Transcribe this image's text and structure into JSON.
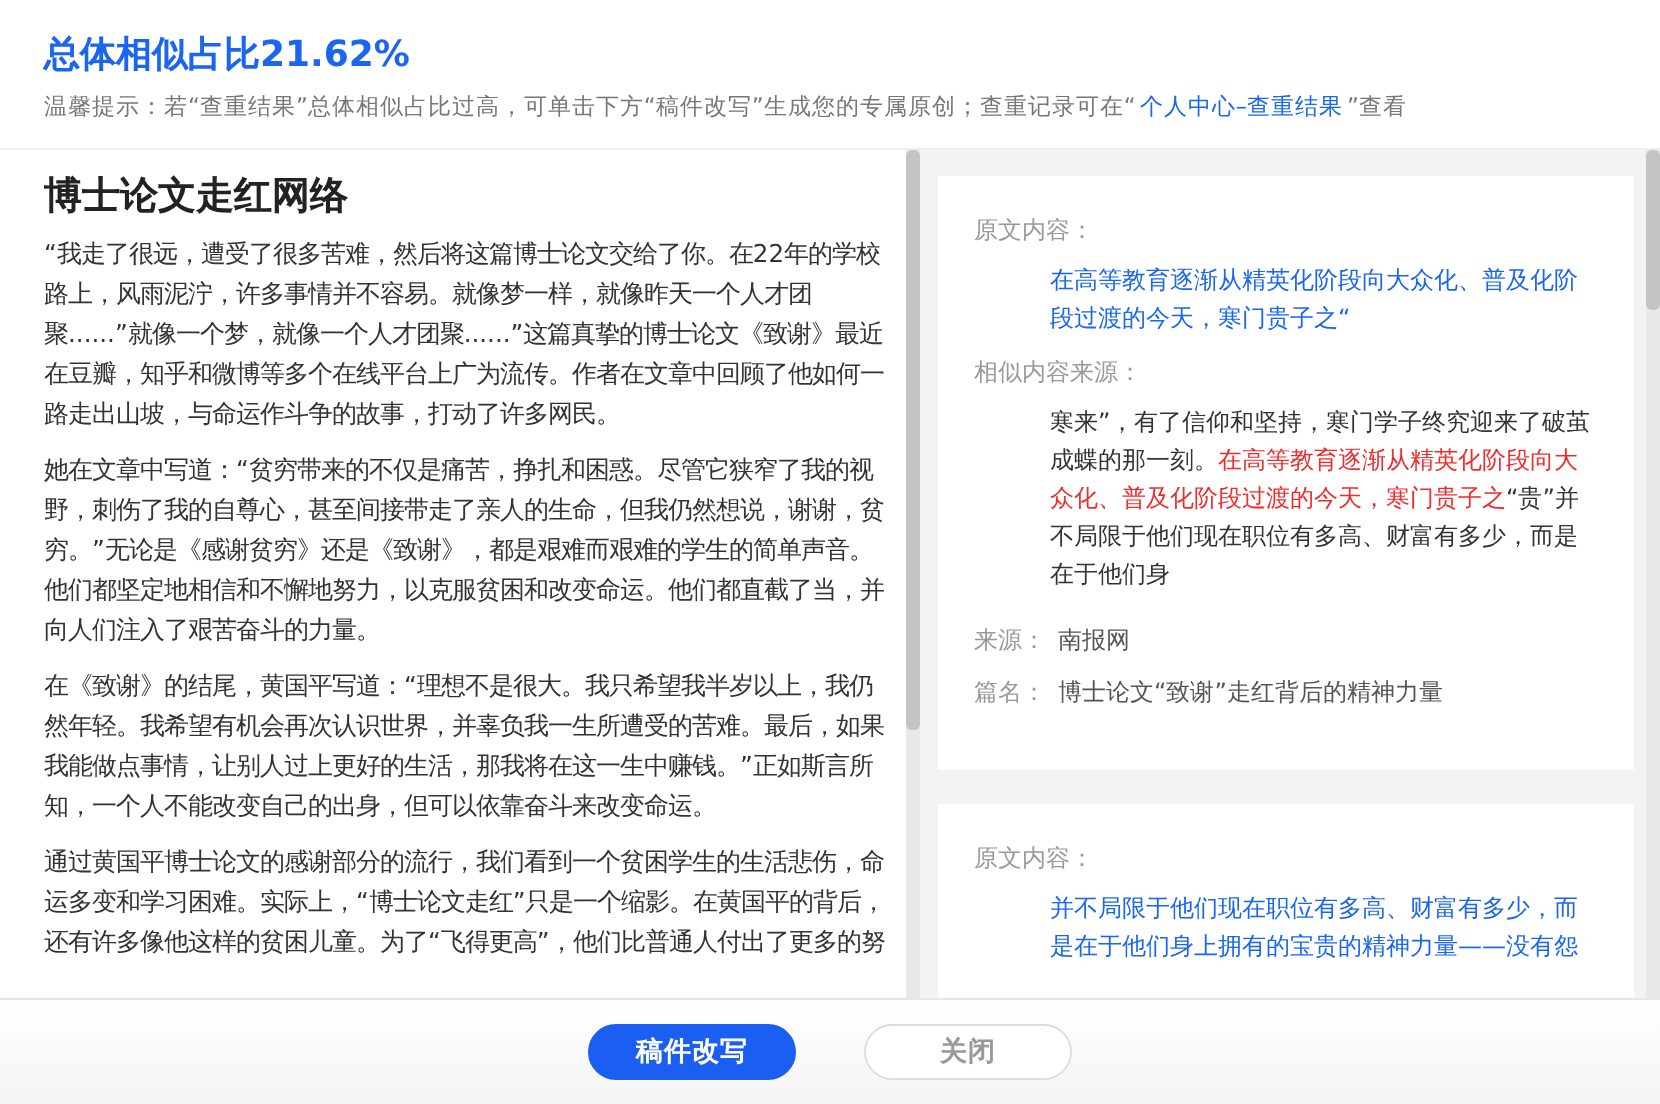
{
  "header": {
    "title": "总体相似占比21.62%",
    "tip_before": "温馨提示：若“查重结果”总体相似占比过高，可单击下方“稿件改写”生成您的专属原创；查重记录可在“",
    "tip_link": "个人中心–查重结果",
    "tip_after": "”查看"
  },
  "article": {
    "title": "博士论文走红网络",
    "paragraphs": [
      "“我走了很远，遭受了很多苦难，然后将这篇博士论文交给了你。在22年的学校路上，风雨泥泞，许多事情并不容易。就像梦一样，就像昨天一个人才团聚......”就像一个梦，就像一个人才团聚......”这篇真挚的博士论文《致谢》最近在豆瓣，知乎和微博等多个在线平台上广为流传。作者在文章中回顾了他如何一路走出山坡，与命运作斗争的故事，打动了许多网民。",
      "她在文章中写道：“贫穷带来的不仅是痛苦，挣扎和困惑。尽管它狭窄了我的视野，刺伤了我的自尊心，甚至间接带走了亲人的生命，但我仍然想说，谢谢，贫穷。”无论是《感谢贫穷》还是《致谢》，都是艰难而艰难的学生的简单声音。他们都坚定地相信和不懈地努力，以克服贫困和改变命运。他们都直截了当，并向人们注入了艰苦奋斗的力量。",
      "在《致谢》的结尾，黄国平写道：“理想不是很大。我只希望我半岁以上，我仍然年轻。我希望有机会再次认识世界，并辜负我一生所遭受的苦难。最后，如果我能做点事情，让别人过上更好的生活，那我将在这一生中赚钱。”正如斯言所知，一个人不能改变自己的出身，但可以依靠奋斗来改变命运。",
      "通过黄国平博士论文的感谢部分的流行，我们看到一个贫困学生的生活悲伤，命运多变和学习困难。实际上，“博士论文走红”只是一个缩影。在黄国平的背后，还有许多像他这样的贫困儿童。为了“飞得更高”，他们比普通人付出了更多的努"
    ]
  },
  "matches": [
    {
      "original_label": "原文内容：",
      "original": "在高等教育逐渐从精英化阶段向大众化、普及化阶段过渡的今天，寒门贵子之“",
      "similar_label": "相似内容来源：",
      "similar": [
        {
          "text": "寒来”，有了信仰和坚持，寒门学子终究迎来了破茧成蝶的那一刻。",
          "highlighted": false
        },
        {
          "text": "在高等教育逐渐从精英化阶段向大众化、普及化阶段过渡的今天，寒门贵子之",
          "highlighted": true
        },
        {
          "text": "“贵”并不局限于他们现在职位有多高、财富有多少，而是在于他们身",
          "highlighted": false
        }
      ],
      "source_label": "来源：",
      "source": "南报网",
      "title_label": "篇名：",
      "title": "博士论文“致谢”走红背后的精神力量"
    },
    {
      "original_label": "原文内容：",
      "original": "并不局限于他们现在职位有多高、财富有多少，而是在于他们身上拥有的宝贵的精神力量——没有怨"
    }
  ],
  "buttons": [
    {
      "label": "稿件改写",
      "primary": true
    },
    {
      "label": "关闭",
      "primary": false
    }
  ]
}
